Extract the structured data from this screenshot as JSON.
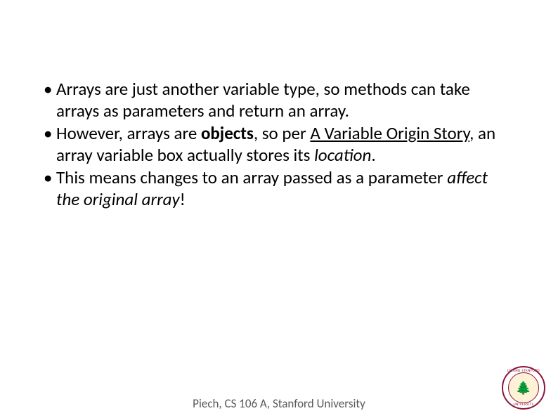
{
  "bullets": [
    {
      "prefix": "• ",
      "t1": "Arrays are just another variable type, so methods can take arrays as parameters and return an array."
    },
    {
      "prefix": "• ",
      "t1": "However, arrays are ",
      "bold": "objects",
      "t2": ", so per ",
      "underline": "A Variable Origin Story",
      "t3": ", an array variable box actually stores its ",
      "italic": "location",
      "t4": "."
    },
    {
      "prefix": "• ",
      "t1": "This means changes to an array passed as a parameter ",
      "italic": "affect the original array",
      "t4": "!"
    }
  ],
  "footer": "Piech, CS 106 A, Stanford University",
  "seal": {
    "tree": "🌲",
    "top_text": "LELAND STANFORD",
    "bottom_text": "UNIVERSITY"
  }
}
